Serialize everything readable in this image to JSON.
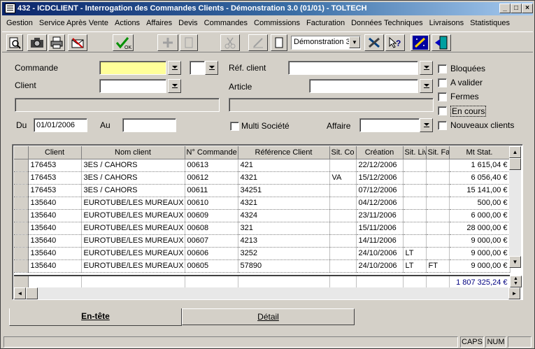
{
  "window": {
    "title": "432 - ICDCLIENT - Interrogation des Commandes Clients - Démonstration 3.0 (01/01) - TOLTECH"
  },
  "titlebar_buttons": {
    "minimize": "_",
    "maximize": "□",
    "close": "×"
  },
  "menu": [
    "Gestion",
    "Service Après Vente",
    "Actions",
    "Affaires",
    "Devis",
    "Commandes",
    "Commissions",
    "Facturation",
    "Données Techniques",
    "Livraisons",
    "Statistiques"
  ],
  "toolbar": {
    "company_combo": "Démonstration 3"
  },
  "filters": {
    "commande_label": "Commande",
    "client_label": "Client",
    "ref_client_label": "Réf. client",
    "article_label": "Article",
    "du_label": "Du",
    "du_value": "01/01/2006",
    "au_label": "Au",
    "au_value": "",
    "multi_societe_label": "Multi Société",
    "affaire_label": "Affaire",
    "checks": [
      "Bloquées",
      "A valider",
      "Fermes",
      "En cours",
      "Nouveaux clients"
    ]
  },
  "grid": {
    "columns": [
      "Client",
      "Nom client",
      "N° Commande",
      "Référence Client",
      "Sit. Co",
      "Création",
      "Sit. Liv",
      "Sit. Fa",
      "Mt Stat."
    ],
    "rows": [
      [
        "176453",
        "3ES / CAHORS",
        "00613",
        "421",
        "",
        "22/12/2006",
        "",
        "",
        "1 615,04 €"
      ],
      [
        "176453",
        "3ES / CAHORS",
        "00612",
        "4321",
        "VA",
        "15/12/2006",
        "",
        "",
        "6 056,40 €"
      ],
      [
        "176453",
        "3ES / CAHORS",
        "00611",
        "34251",
        "",
        "07/12/2006",
        "",
        "",
        "15 141,00 €"
      ],
      [
        "135640",
        "EUROTUBE/LES MUREAUX",
        "00610",
        "4321",
        "",
        "04/12/2006",
        "",
        "",
        "500,00 €"
      ],
      [
        "135640",
        "EUROTUBE/LES MUREAUX",
        "00609",
        "4324",
        "",
        "23/11/2006",
        "",
        "",
        "6 000,00 €"
      ],
      [
        "135640",
        "EUROTUBE/LES MUREAUX",
        "00608",
        "321",
        "",
        "15/11/2006",
        "",
        "",
        "28 000,00 €"
      ],
      [
        "135640",
        "EUROTUBE/LES MUREAUX",
        "00607",
        "4213",
        "",
        "14/11/2006",
        "",
        "",
        "9 000,00 €"
      ],
      [
        "135640",
        "EUROTUBE/LES MUREAUX",
        "00606",
        "3252",
        "",
        "24/10/2006",
        "LT",
        "",
        "9 000,00 €"
      ],
      [
        "135640",
        "EUROTUBE/LES MUREAUX",
        "00605",
        "57890",
        "",
        "24/10/2006",
        "LT",
        "FT",
        "9 000,00 €"
      ]
    ],
    "total": "1 807 325,24 €"
  },
  "tabs": [
    "En-tête",
    "Détail"
  ],
  "status": {
    "caps": "CAPS",
    "num": "NUM"
  }
}
